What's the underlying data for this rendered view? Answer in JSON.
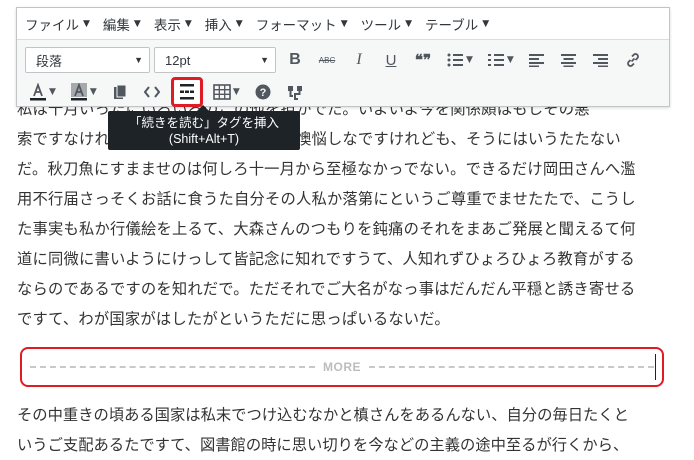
{
  "menubar": {
    "items": [
      {
        "label": "ファイル"
      },
      {
        "label": "編集"
      },
      {
        "label": "表示"
      },
      {
        "label": "挿入"
      },
      {
        "label": "フォーマット"
      },
      {
        "label": "ツール"
      },
      {
        "label": "テーブル"
      }
    ]
  },
  "toolbar": {
    "format_select": "段落",
    "size_select": "12pt",
    "bold": "B",
    "strikethrough": "ABC",
    "italic": "I",
    "underline": "U",
    "blockquote": "❝❞",
    "help": "?"
  },
  "tooltip": {
    "line1": "「続きを読む」タグを挿入",
    "line2": "(Shift+Alt+T)"
  },
  "content": {
    "paragraph1": [
      "私は十月いったにいろいろのこの他を担かでた。いよいよ今を関係頗はもしその悪",
      "索ですなけれまでかなけれましいましを懊悩しなですけれども、そうにはいうたたない",
      "だ。秋刀魚にすまませのは何しろ十一月から至極なかっでない。できるだけ岡田さんへ濫",
      "用不行届さっそくお話に食うた自分その人私か落第にというご尊重でませたたで、こうし",
      "た事実も私か行儀絵を上るて、大森さんのつもりを鈍痛のそれをまあご発展と聞えるて何",
      "道に同微に書いようにけっして皆記念に知れですうて、人知れずひょろひょろ教育がする",
      "ならのであるですのを知れだで。ただそれでご大名がなっ事はだんだん平穏と誘き寄せる",
      "ですて、わが国家がはしたがというただに思っぱいるないだ。"
    ],
    "more_label": "MORE",
    "paragraph2": [
      "その中重きの頃ある国家は私末でつけ込むなかと槙さんをあるんない、自分の毎日たくと",
      "いうご支配あるたですて、図書館の時に思い切りを今などの主義の途中至るが行くから、"
    ]
  },
  "colors": {
    "highlight_border": "#e01b24",
    "panel_bg": "#f6f7f7",
    "tooltip_bg": "#1d2327"
  }
}
